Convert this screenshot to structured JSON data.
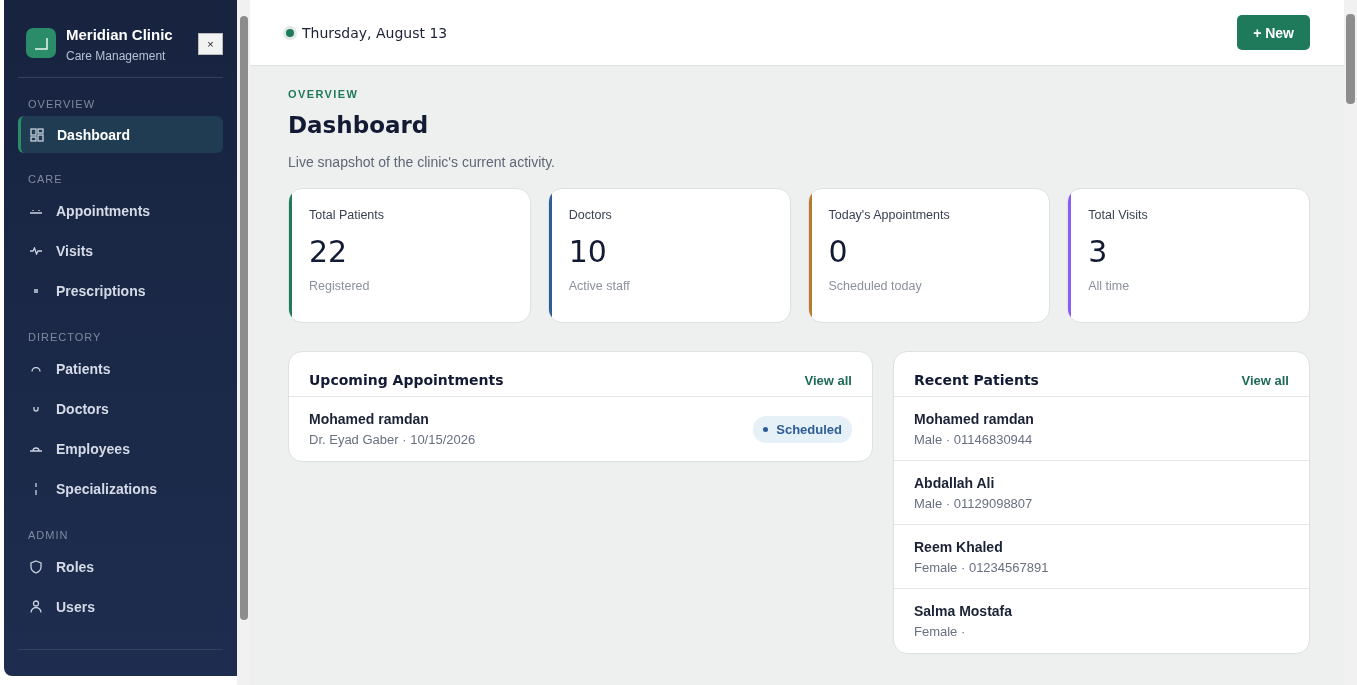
{
  "sidebar": {
    "brand": {
      "name": "Meridian Clinic",
      "subtitle": "Care Management",
      "close": "×"
    },
    "sections": [
      {
        "title": "OVERVIEW",
        "items": [
          {
            "label": "Dashboard",
            "selected": true
          }
        ]
      },
      {
        "title": "CARE",
        "items": [
          {
            "label": "Appointments",
            "selected": false
          },
          {
            "label": "Visits",
            "selected": false
          },
          {
            "label": "Prescriptions",
            "selected": false
          }
        ]
      },
      {
        "title": "DIRECTORY",
        "items": [
          {
            "label": "Patients",
            "selected": false
          },
          {
            "label": "Doctors",
            "selected": false
          },
          {
            "label": "Employees",
            "selected": false
          },
          {
            "label": "Specializations",
            "selected": false
          }
        ]
      },
      {
        "title": "ADMIN",
        "items": [
          {
            "label": "Roles",
            "selected": false
          },
          {
            "label": "Users",
            "selected": false
          }
        ]
      }
    ]
  },
  "topbar": {
    "date": "Thursday, August 13",
    "new_button": "+ New"
  },
  "header": {
    "eyebrow": "OVERVIEW",
    "title": "Dashboard",
    "subtitle": "Live snapshot of the clinic's current activity."
  },
  "stats": [
    {
      "label": "Total Patients",
      "value": "22",
      "note": "Registered",
      "color": "#1f7a5c"
    },
    {
      "label": "Doctors",
      "value": "10",
      "note": "Active staff",
      "color": "#2c5d96"
    },
    {
      "label": "Today's Appointments",
      "value": "0",
      "note": "Scheduled today",
      "color": "#b87a2a"
    },
    {
      "label": "Total Visits",
      "value": "3",
      "note": "All time",
      "color": "#8b5cf6"
    }
  ],
  "upcoming": {
    "title": "Upcoming Appointments",
    "link": "View all",
    "rows": [
      {
        "name": "Mohamed ramdan",
        "detail": "Dr. Eyad Gaber · 10/15/2026",
        "status": "Scheduled"
      }
    ]
  },
  "recent": {
    "title": "Recent Patients",
    "link": "View all",
    "rows": [
      {
        "name": "Mohamed ramdan",
        "detail": "Male · 01146830944"
      },
      {
        "name": "Abdallah Ali",
        "detail": "Male · 01129098807"
      },
      {
        "name": "Reem Khaled",
        "detail": "Female · 01234567891"
      },
      {
        "name": "Salma Mostafa",
        "detail": "Female ·"
      }
    ]
  }
}
